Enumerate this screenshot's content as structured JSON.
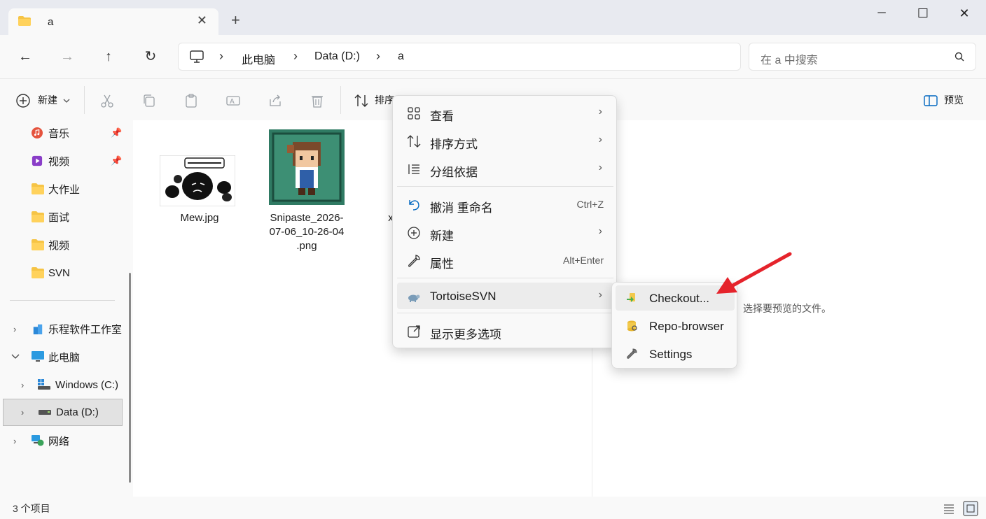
{
  "window": {
    "tab_title": "a",
    "tab_close": "✕",
    "new_tab": "+",
    "minimize": "─",
    "maximize": "☐",
    "close": "✕"
  },
  "nav": {
    "back": "←",
    "forward": "→",
    "up": "↑",
    "refresh": "↻"
  },
  "address": {
    "crumbs": [
      "此电脑",
      "Data (D:)",
      "a"
    ],
    "sep": "›"
  },
  "search": {
    "placeholder": "在 a 中搜索"
  },
  "commands": {
    "new_label": "新建",
    "sort_label": "排序",
    "preview_label": "预览"
  },
  "sidebar": {
    "items": [
      {
        "label": "音乐"
      },
      {
        "label": "视频"
      },
      {
        "label": "大作业"
      },
      {
        "label": "面试"
      },
      {
        "label": "视频"
      },
      {
        "label": "SVN"
      },
      {
        "label": "乐程软件工作室"
      },
      {
        "label": "此电脑"
      },
      {
        "label": "Windows (C:)"
      },
      {
        "label": "Data (D:)"
      },
      {
        "label": "网络"
      }
    ]
  },
  "files": [
    {
      "name": "Mew.jpg"
    },
    {
      "name": "Snipaste_2026-07-06_10-26-04.png",
      "lines": [
        "Snipaste_2026-",
        "07-06_10-26-04",
        ".png"
      ]
    },
    {
      "name": "x"
    }
  ],
  "preview": {
    "empty_text": "选择要预览的文件。"
  },
  "status": {
    "count": "3 个项目"
  },
  "context_menu": {
    "items": [
      {
        "label": "查看",
        "shortcut": "",
        "submenu": true
      },
      {
        "label": "排序方式",
        "shortcut": "",
        "submenu": true
      },
      {
        "label": "分组依据",
        "shortcut": "",
        "submenu": true
      },
      {
        "label": "撤消 重命名",
        "shortcut": "Ctrl+Z",
        "submenu": false
      },
      {
        "label": "新建",
        "shortcut": "",
        "submenu": true
      },
      {
        "label": "属性",
        "shortcut": "Alt+Enter",
        "submenu": false
      },
      {
        "label": "TortoiseSVN",
        "shortcut": "",
        "submenu": true
      },
      {
        "label": "显示更多选项",
        "shortcut": "",
        "submenu": false
      }
    ],
    "arrow": "›"
  },
  "svn_submenu": {
    "items": [
      {
        "label": "Checkout..."
      },
      {
        "label": "Repo-browser"
      },
      {
        "label": "Settings"
      }
    ]
  },
  "colors": {
    "accent": "#0067c0",
    "folder": "#f6c445",
    "annotation_arrow": "#e5232b"
  }
}
